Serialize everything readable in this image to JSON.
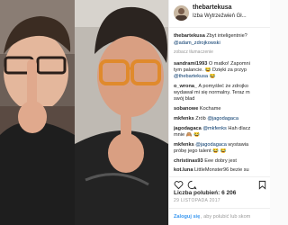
{
  "post": {
    "username": "thebartekusa",
    "location": "Izba Wytrzeźwień Gł...",
    "caption": {
      "user": "thebartekusa",
      "text": "Zbyt inteligentnie? ",
      "tag": "@adam_zdrojkowski"
    },
    "see_translation": "zobacz tłumaczenie",
    "comments": [
      {
        "user": "sandrami1993",
        "text": " O matko! Zapomni",
        "line2": "tym palancie. 😂 Dzięki za przyp",
        "line3": "@thebartekusa 😂"
      },
      {
        "user": "o_wrona_",
        "text": " A pomyśleć że zdrojko",
        "line2": "wydawał mi się normalny. Teraz m",
        "line3": "swój blad"
      },
      {
        "user": "sobanowe",
        "text": " Kochame"
      },
      {
        "user": "mkfenks",
        "text": " Zrób ",
        "mention": "@jagodagaca"
      },
      {
        "user": "jagodagaca",
        "mention_first": "@mkfenks",
        "text": " Hah dlacz",
        "line2": "mnie 🙈 😂"
      },
      {
        "user": "mkfenks",
        "mention_first": "@jagodagaca",
        "text": " wystawia",
        "line2": "próbę jego talent 😂 😂"
      },
      {
        "user": "christinas93",
        "text": " Eee dobry jest"
      },
      {
        "user": "kot.luna",
        "text": " LittleMonster96 bezie su"
      }
    ],
    "likes_label": "Liczba polubień: 6 206",
    "date": "29 LISTOPADA 2017",
    "login_link": "Zaloguj się",
    "login_text": ", aby polubić lub skom"
  },
  "icons": [
    "heart-icon",
    "comment-icon",
    "bookmark-icon"
  ]
}
